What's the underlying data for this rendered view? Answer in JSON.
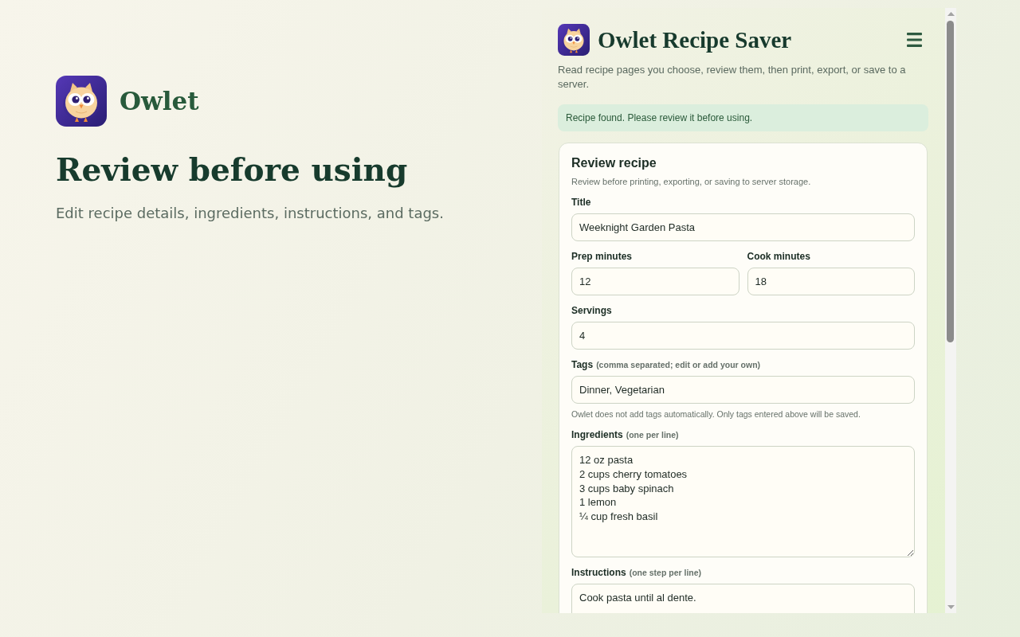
{
  "hero": {
    "app_name": "Owlet",
    "heading": "Review before using",
    "subtitle": "Edit recipe details, ingredients, instructions, and tags."
  },
  "panel": {
    "title": "Owlet Recipe Saver",
    "description": "Read recipe pages you choose, review them, then print, export, or save to a server.",
    "status": "Recipe found. Please review it before using."
  },
  "review_card": {
    "heading": "Review recipe",
    "subheading": "Review before printing, exporting, or saving to server storage.",
    "rows": [
      {
        "fields": [
          {
            "kind": "input",
            "label": "Title",
            "value": "Weeknight Garden Pasta"
          }
        ]
      },
      {
        "fields": [
          {
            "kind": "input",
            "label": "Prep minutes",
            "value": "12"
          },
          {
            "kind": "input",
            "label": "Cook minutes",
            "value": "18"
          }
        ]
      },
      {
        "fields": [
          {
            "kind": "input",
            "label": "Servings",
            "value": "4"
          }
        ]
      },
      {
        "fields": [
          {
            "kind": "input",
            "label": "Tags",
            "hint": "(comma separated; edit or add your own)",
            "value": "Dinner, Vegetarian",
            "help": "Owlet does not add tags automatically. Only tags entered above will be saved."
          }
        ]
      },
      {
        "fields": [
          {
            "kind": "textarea",
            "label": "Ingredients",
            "hint": "(one per line)",
            "lines": [
              "12 oz pasta",
              "2 cups cherry tomatoes",
              "3 cups baby spinach",
              "1 lemon",
              "¼ cup fresh basil"
            ]
          }
        ]
      },
      {
        "fields": [
          {
            "kind": "textarea",
            "label": "Instructions",
            "hint": "(one step per line)",
            "lines": [
              "Cook pasta until al dente."
            ]
          }
        ]
      }
    ]
  }
}
